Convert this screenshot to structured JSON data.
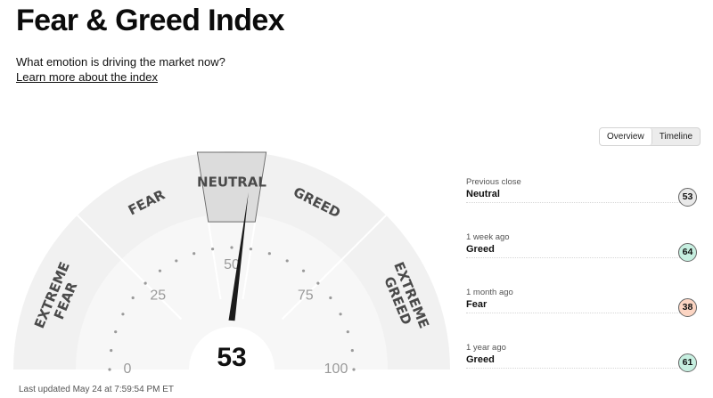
{
  "header": {
    "title": "Fear & Greed Index",
    "subtitle": "What emotion is driving the market now?",
    "learn_link": "Learn more about the index"
  },
  "gauge": {
    "value": 53,
    "current_rating": "NEUTRAL",
    "segments": [
      {
        "label": "EXTREME FEAR",
        "lines": [
          "EXTREME",
          "FEAR"
        ],
        "from": 0,
        "to": 25
      },
      {
        "label": "FEAR",
        "lines": [
          "FEAR"
        ],
        "from": 25,
        "to": 45
      },
      {
        "label": "NEUTRAL",
        "lines": [
          "NEUTRAL"
        ],
        "from": 45,
        "to": 55
      },
      {
        "label": "GREED",
        "lines": [
          "GREED"
        ],
        "from": 55,
        "to": 75
      },
      {
        "label": "EXTREME GREED",
        "lines": [
          "EXTREME",
          "GREED"
        ],
        "from": 75,
        "to": 100
      }
    ],
    "scale_labels": [
      "0",
      "25",
      "50",
      "75",
      "100"
    ],
    "colors": {
      "ring": "#f1f1f1",
      "highlight": "#dcdcdc",
      "segment_text": "#4a4a4a",
      "needle": "#1b1b1b"
    }
  },
  "view_tabs": [
    {
      "label": "Overview",
      "active": true
    },
    {
      "label": "Timeline",
      "active": false
    }
  ],
  "history": [
    {
      "label": "Previous close",
      "rating": "Neutral",
      "value": "53",
      "color": "#e9e9e9"
    },
    {
      "label": "1 week ago",
      "rating": "Greed",
      "value": "64",
      "color": "#c6efe0"
    },
    {
      "label": "1 month ago",
      "rating": "Fear",
      "value": "38",
      "color": "#fcd5c3"
    },
    {
      "label": "1 year ago",
      "rating": "Greed",
      "value": "61",
      "color": "#c6efe0"
    }
  ],
  "footer": {
    "last_updated": "Last updated May 24 at 7:59:54 PM ET"
  }
}
